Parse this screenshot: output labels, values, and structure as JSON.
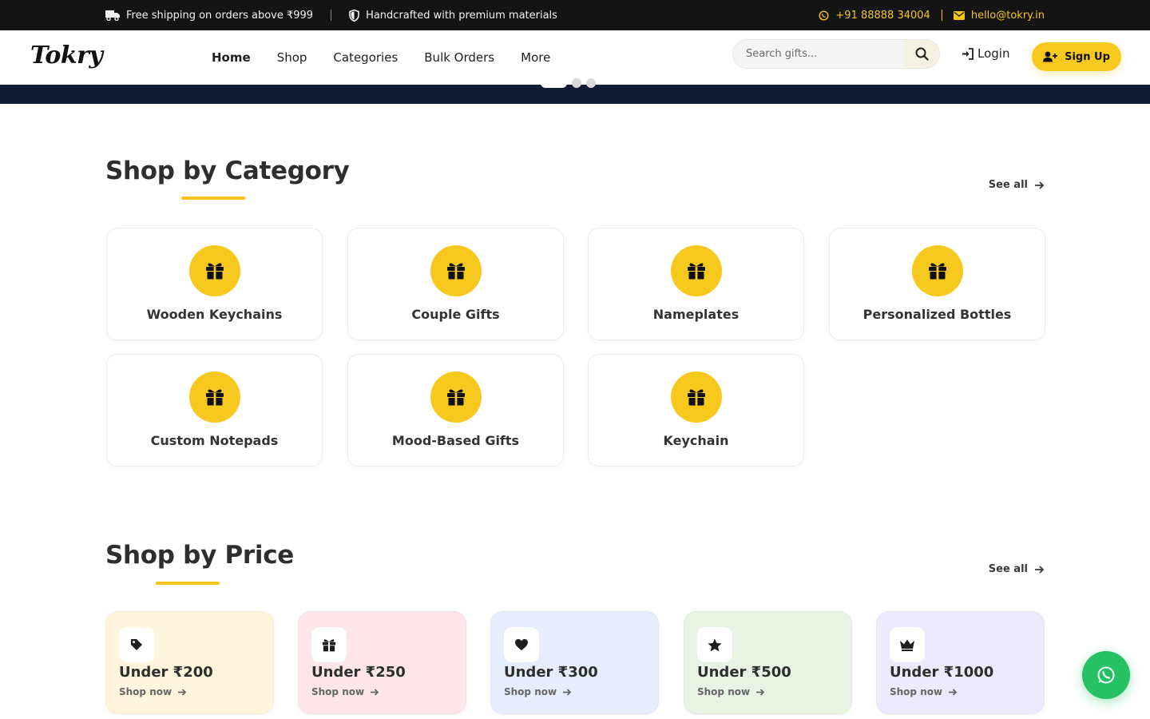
{
  "topbar": {
    "shipping": "Free shipping on orders above ₹999",
    "handcrafted": "Handcrafted with premium materials",
    "phone": "+91 88888 34004",
    "email": "hello@tokry.in"
  },
  "header": {
    "logo": "Tokry",
    "nav": [
      "Home",
      "Shop",
      "Categories",
      "Bulk Orders",
      "More"
    ],
    "active_nav": "Home",
    "search_placeholder": "Search gifts...",
    "login_label": "Login",
    "signup_label": "Sign Up"
  },
  "hero": {
    "slides": 3,
    "active_slide": 1
  },
  "categories": {
    "title": "Shop by Category",
    "see_all": "See all",
    "items": [
      {
        "label": "Wooden Keychains",
        "icon": "gift-icon"
      },
      {
        "label": "Couple Gifts",
        "icon": "gift-icon"
      },
      {
        "label": "Nameplates",
        "icon": "gift-icon"
      },
      {
        "label": "Personalized Bottles",
        "icon": "gift-icon"
      },
      {
        "label": "Custom Notepads",
        "icon": "gift-icon"
      },
      {
        "label": "Mood-Based Gifts",
        "icon": "gift-icon"
      },
      {
        "label": "Keychain",
        "icon": "gift-icon"
      }
    ]
  },
  "price": {
    "title": "Shop by Price",
    "see_all": "See all",
    "items": [
      {
        "label": "Under ₹200",
        "link": "Shop now",
        "icon": "tag-icon",
        "bg": "#fff4dc"
      },
      {
        "label": "Under ₹250",
        "link": "Shop now",
        "icon": "gift-icon",
        "bg": "#fde6ea"
      },
      {
        "label": "Under ₹300",
        "link": "Shop now",
        "icon": "heart-icon",
        "bg": "#e4eefd"
      },
      {
        "label": "Under ₹500",
        "link": "Shop now",
        "icon": "star-icon",
        "bg": "#e5f5e2"
      },
      {
        "label": "Under ₹1000",
        "link": "Shop now",
        "icon": "crown-icon",
        "bg": "#eeeafd"
      }
    ]
  },
  "colors": {
    "accent": "#f7c81e",
    "dark": "#141414",
    "hero": "#0f1c33",
    "whatsapp": "#25c164"
  }
}
